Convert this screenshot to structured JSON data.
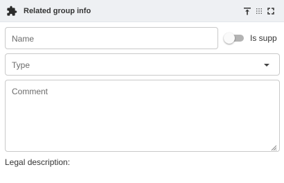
{
  "header": {
    "title": "Related group info",
    "icon": "puzzle-icon",
    "actions": [
      "pin-top-icon",
      "grid-icon",
      "fullscreen-icon"
    ]
  },
  "form": {
    "name_placeholder": "Name",
    "toggle_label": "Is supp",
    "toggle_on": false,
    "type_placeholder": "Type",
    "comment_placeholder": "Comment",
    "legal_label": "Legal description:"
  },
  "colors": {
    "header_bg": "#eef0f3",
    "border": "#c9c9c9",
    "toggle_track": "#b3b3b3"
  }
}
